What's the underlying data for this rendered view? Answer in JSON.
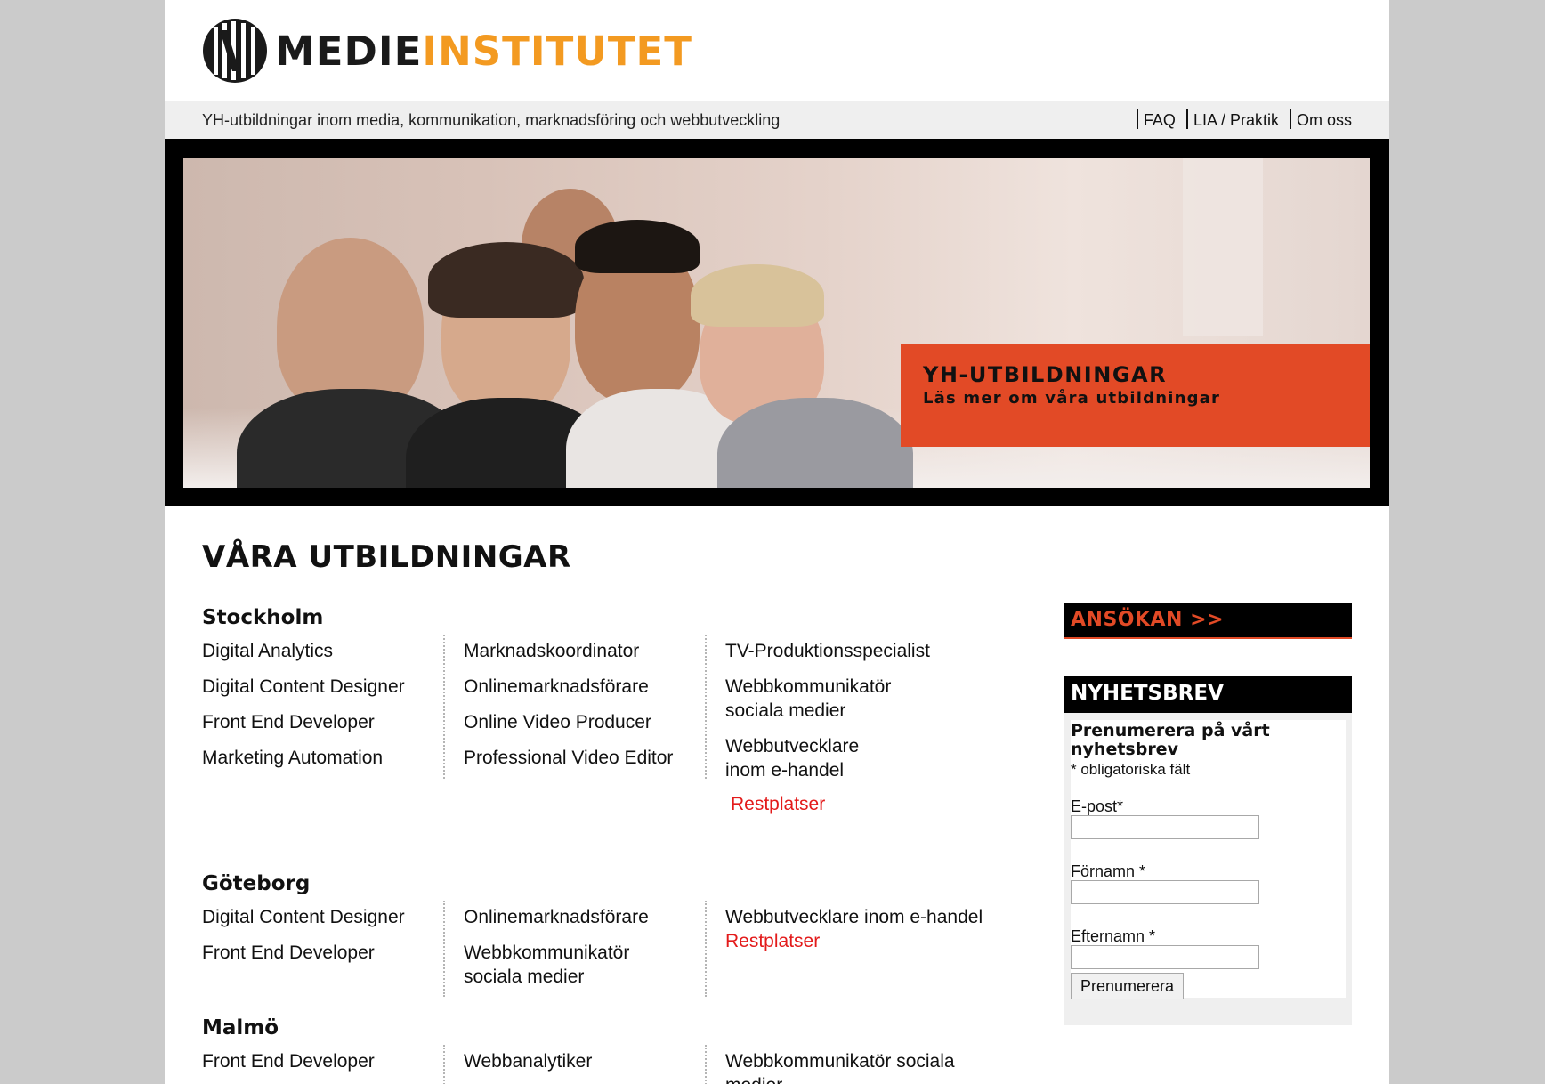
{
  "header": {
    "logo_part1": "MEDIE",
    "logo_part2": "INSTITUTET",
    "tagline": "YH-utbildningar inom media, kommunikation, marknadsföring och webbutveckling",
    "nav": [
      "FAQ",
      "LIA / Praktik",
      "Om oss"
    ]
  },
  "hero": {
    "title": "YH-UTBILDNINGAR",
    "subtitle": "Läs mer om våra utbildningar"
  },
  "main": {
    "title": "VÅRA UTBILDNINGAR",
    "stockholm": {
      "name": "Stockholm",
      "col1": [
        "Digital Analytics",
        "Digital Content Designer",
        "Front End Developer",
        "Marketing Automation"
      ],
      "col2": [
        "Marknadskoordinator",
        "Onlinemarknadsförare",
        "Online Video Producer",
        "Professional Video Editor"
      ],
      "col3_1": "TV-Produktionsspecialist",
      "col3_2a": "Webbkommunikatör",
      "col3_2b": "sociala medier",
      "col3_3a": "Webbutvecklare",
      "col3_3b": "inom e-handel",
      "col3_rest": "Restplatser"
    },
    "goteborg": {
      "name": "Göteborg",
      "col1": [
        "Digital Content Designer",
        "Front End Developer"
      ],
      "col2_1": "Onlinemarknadsförare",
      "col2_2a": "Webbkommunikatör",
      "col2_2b": "sociala medier",
      "col3_1": "Webbutvecklare inom e-handel",
      "col3_rest": "Restplatser"
    },
    "malmo": {
      "name": "Malmö",
      "col1": [
        "Front End Developer"
      ],
      "col2": [
        "Webbanalytiker"
      ],
      "col3_1": "Webbkommunikatör sociala",
      "col3_2": "medier"
    }
  },
  "sidebar": {
    "apply": "ANSÖKAN >>",
    "newsletter": {
      "heading": "NYHETSBREV",
      "title": "Prenumerera på vårt nyhetsbrev",
      "required_note": "* obligatoriska fält",
      "email_label": "E-post*",
      "firstname_label": "Förnamn *",
      "lastname_label": "Efternamn *",
      "submit": "Prenumerera"
    }
  },
  "colors": {
    "orange": "#f39a21",
    "accent_red": "#e24a26",
    "link_red": "#e31b1b"
  }
}
